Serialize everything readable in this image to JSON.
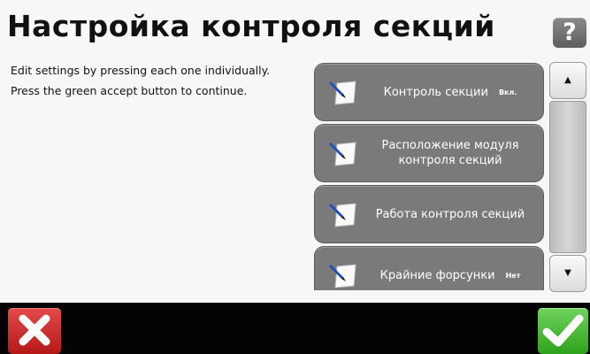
{
  "header": {
    "title": "Настройка контроля секций",
    "help_label": "?"
  },
  "instructions": [
    "Edit settings by pressing each one individually.",
    "Press the green accept button to continue."
  ],
  "settings": [
    {
      "label": "Контроль секции",
      "value": "Вкл.",
      "icon": "edit-icon"
    },
    {
      "label": "Расположение модуля контроля секций",
      "value": "",
      "icon": "edit-icon"
    },
    {
      "label": "Работа контроля секций",
      "value": "",
      "icon": "edit-icon"
    },
    {
      "label": "Крайние форсунки",
      "value": "Нет",
      "icon": "edit-icon"
    }
  ],
  "scroll": {
    "up_glyph": "▲",
    "down_glyph": "▼"
  },
  "footer": {
    "cancel_icon": "x-icon",
    "accept_icon": "checkmark-icon"
  },
  "colors": {
    "item_bg": "#7a7a7a",
    "cancel": "#d32f2f",
    "accept": "#4cbb37",
    "footer_bg": "#030303"
  }
}
